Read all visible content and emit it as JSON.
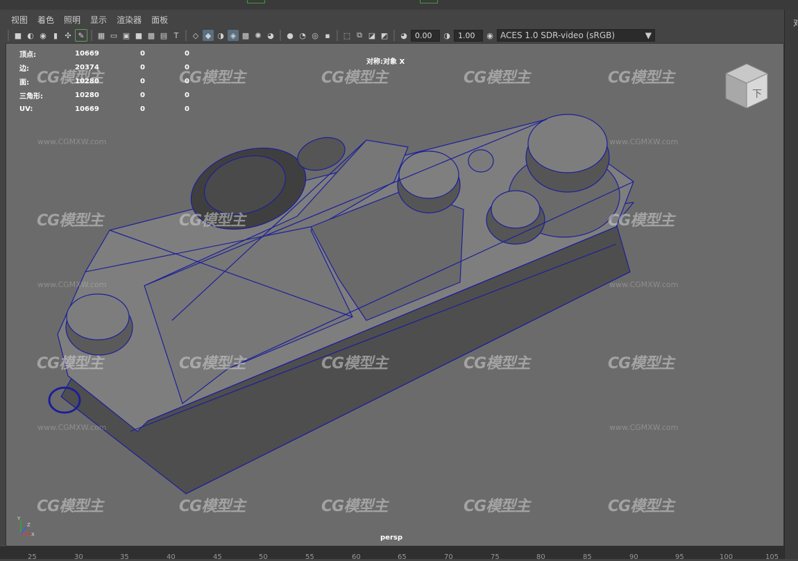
{
  "menu": [
    "视图",
    "着色",
    "照明",
    "显示",
    "渲染器",
    "面板"
  ],
  "toolbar": {
    "exposure": "0.00",
    "gamma": "1.00",
    "colorspace": "ACES 1.0 SDR-video (sRGB)"
  },
  "hud": {
    "rows": [
      {
        "label": "顶点:",
        "v1": "10669",
        "v2": "0",
        "v3": "0"
      },
      {
        "label": "边:",
        "v1": "20374",
        "v2": "0",
        "v3": "0"
      },
      {
        "label": "面:",
        "v1": "10280",
        "v2": "0",
        "v3": "0"
      },
      {
        "label": "三角形:",
        "v1": "10280",
        "v2": "0",
        "v3": "0"
      },
      {
        "label": "UV:",
        "v1": "10669",
        "v2": "0",
        "v3": "0"
      }
    ],
    "symmetry": "对称:对象 X"
  },
  "camera": "persp",
  "viewcube_label": "下",
  "side_char": "对",
  "axis": {
    "x": "X",
    "y": "Y",
    "z": "Z"
  },
  "watermark": {
    "logo": "CG模型主",
    "url": "www.CGMXW.com"
  },
  "ruler": [
    "25",
    "30",
    "35",
    "40",
    "45",
    "50",
    "55",
    "60",
    "65",
    "70",
    "75",
    "80",
    "85",
    "90",
    "95",
    "100",
    "105"
  ],
  "colors": {
    "wire": "#1c1f9a",
    "viewport": "#6b6b6b",
    "mesh": "#7a7a7a"
  }
}
